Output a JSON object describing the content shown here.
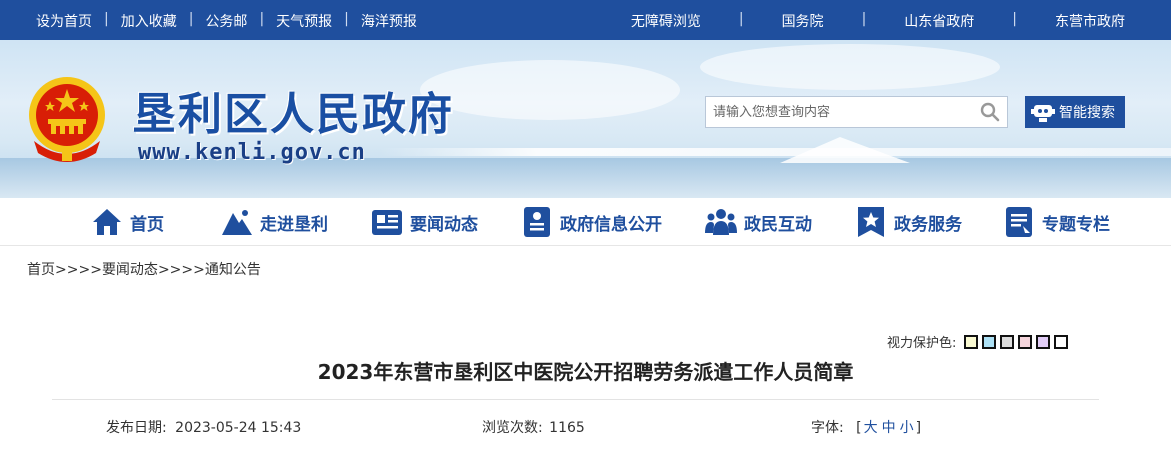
{
  "topbar": {
    "left_links": [
      "设为首页",
      "加入收藏",
      "公务邮",
      "天气预报",
      "海洋预报"
    ],
    "right_links": [
      "无障碍浏览",
      "国务院",
      "山东省政府",
      "东营市政府"
    ],
    "separator": "|"
  },
  "header": {
    "title": "垦利区人民政府",
    "url": "www.kenli.gov.cn",
    "search_placeholder": "请输入您想查询内容",
    "smart_search_label": "智能搜索"
  },
  "nav": {
    "items": [
      {
        "label": "首页",
        "icon": "home-icon"
      },
      {
        "label": "走进垦利",
        "icon": "mountain-icon"
      },
      {
        "label": "要闻动态",
        "icon": "news-icon"
      },
      {
        "label": "政府信息公开",
        "icon": "document-icon"
      },
      {
        "label": "政民互动",
        "icon": "people-icon"
      },
      {
        "label": "政务服务",
        "icon": "star-badge-icon"
      },
      {
        "label": "专题专栏",
        "icon": "topic-icon"
      }
    ]
  },
  "breadcrumb": {
    "items": [
      "首页",
      "要闻动态",
      "通知公告"
    ],
    "separator": ">>"
  },
  "article": {
    "eye_label": "视力保护色:",
    "eye_colors": [
      "#fafad2",
      "#ade1f5",
      "#dcdcdc",
      "#f5d5dc",
      "#e2cdf7",
      "#ffffff"
    ],
    "title": "2023年东营市垦利区中医院公开招聘劳务派遣工作人员简章",
    "date_label": "发布日期:",
    "date_value": "2023-05-24 15:43",
    "views_label": "浏览次数:",
    "views_value": "1165",
    "font_label": "字体:",
    "font_open": "[",
    "font_sizes": [
      "大",
      "中",
      "小"
    ],
    "font_close": "]"
  },
  "colors": {
    "brand": "#1f4f9e",
    "emblem_red": "#d81e06",
    "emblem_gold": "#f5c518"
  }
}
